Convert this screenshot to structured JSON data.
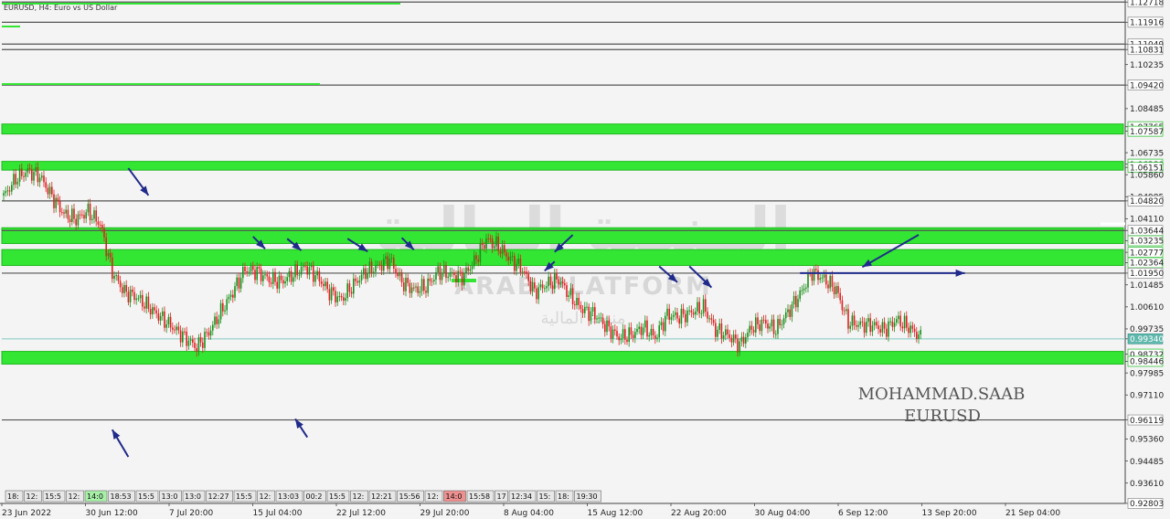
{
  "chart_title": "EURUSD, H4:  Euro vs US Dollar",
  "watermark": {
    "brand_logo": "المنصة المالية",
    "brand_en": "ARAB PLATFORM",
    "brand_ar": "منصة المالية"
  },
  "signature": {
    "author": "MOHAMMAD.SAAB",
    "symbol": "EURUSD"
  },
  "colors": {
    "background": "#f4f4f4",
    "zone": "#33e633",
    "bull": "#1a8f1a",
    "bear": "#e02020",
    "arrow": "#1f2a8a",
    "current_line": "#7fc8c0",
    "level_line": "#555555"
  },
  "price_axis_labels": [
    "1.12718",
    "1.11916",
    "1.11049",
    "1.10831",
    "1.10235",
    "1.09420",
    "1.08485",
    "1.07765",
    "1.07587",
    "1.06735",
    "1.06280",
    "1.06151",
    "1.05860",
    "1.04985",
    "1.04820",
    "1.04110",
    "1.03644",
    "1.03235",
    "1.02777",
    "1.02364",
    "1.01950",
    "1.01485",
    "1.00610",
    "0.99735",
    "0.99340",
    "0.98732",
    "0.98446",
    "0.97985",
    "0.97110",
    "0.96119",
    "0.95360",
    "0.94485",
    "0.93610",
    "0.92803"
  ],
  "time_axis_labels": [
    "23 Jun 2022",
    "30 Jun 12:00",
    "7 Jul 20:00",
    "15 Jul 04:00",
    "22 Jul 12:00",
    "29 Jul 20:00",
    "8 Aug 04:00",
    "15 Aug 12:00",
    "22 Aug 20:00",
    "30 Aug 04:00",
    "6 Sep 12:00",
    "13 Sep 20:00",
    "21 Sep 04:00"
  ],
  "timestamp_boxes": [
    "18:",
    "12:",
    "15:5",
    "12:",
    "14:0",
    "18:53",
    "15:5",
    "13:0",
    "13:0",
    "12:27",
    "15:5",
    "12:",
    "13:03",
    "00:2",
    "15:5",
    "12:",
    "12:21",
    "15:56",
    "12:",
    "14:0",
    "15:58",
    "17",
    "12:34",
    "15:",
    "18:",
    "19:30"
  ],
  "chart_data": {
    "type": "candlestick",
    "symbol": "EURUSD",
    "timeframe": "H4",
    "y_range": [
      0.928,
      1.128
    ],
    "current_price": 0.9934,
    "horizontal_lines": [
      1.12718,
      1.11916,
      1.11049,
      1.10831,
      1.0942,
      1.0482,
      1.03644,
      1.0195,
      0.96119,
      0.92803
    ],
    "zones": [
      {
        "top": 1.07765,
        "bottom": 1.07587
      },
      {
        "top": 1.0628,
        "bottom": 1.06151
      },
      {
        "top": 1.03644,
        "bottom": 1.03235
      },
      {
        "top": 1.02777,
        "bottom": 1.02364
      },
      {
        "top": 0.98732,
        "bottom": 0.98446
      }
    ],
    "close_path": [
      [
        0,
        1.05
      ],
      [
        6,
        1.057
      ],
      [
        12,
        1.06
      ],
      [
        18,
        1.058
      ],
      [
        24,
        1.05
      ],
      [
        30,
        1.043
      ],
      [
        36,
        1.041
      ],
      [
        42,
        1.044
      ],
      [
        48,
        1.039
      ],
      [
        54,
        1.02
      ],
      [
        60,
        1.012
      ],
      [
        66,
        1.01
      ],
      [
        72,
        1.006
      ],
      [
        78,
        1.002
      ],
      [
        84,
        0.998
      ],
      [
        90,
        0.994
      ],
      [
        96,
        0.99
      ],
      [
        102,
        0.996
      ],
      [
        108,
        1.004
      ],
      [
        114,
        1.012
      ],
      [
        120,
        1.021
      ],
      [
        126,
        1.02
      ],
      [
        132,
        1.017
      ],
      [
        138,
        1.016
      ],
      [
        144,
        1.019
      ],
      [
        150,
        1.022
      ],
      [
        156,
        1.018
      ],
      [
        162,
        1.012
      ],
      [
        168,
        1.009
      ],
      [
        174,
        1.015
      ],
      [
        180,
        1.02
      ],
      [
        186,
        1.022
      ],
      [
        192,
        1.025
      ],
      [
        198,
        1.016
      ],
      [
        204,
        1.013
      ],
      [
        210,
        1.014
      ],
      [
        216,
        1.02
      ],
      [
        222,
        1.019
      ],
      [
        228,
        1.018
      ],
      [
        234,
        1.024
      ],
      [
        240,
        1.033
      ],
      [
        246,
        1.03
      ],
      [
        252,
        1.025
      ],
      [
        258,
        1.021
      ],
      [
        264,
        1.012
      ],
      [
        270,
        1.015
      ],
      [
        276,
        1.017
      ],
      [
        282,
        1.01
      ],
      [
        288,
        1.005
      ],
      [
        294,
        1.003
      ],
      [
        300,
        0.998
      ],
      [
        306,
        0.994
      ],
      [
        312,
        0.995
      ],
      [
        318,
        0.998
      ],
      [
        324,
        0.994
      ],
      [
        330,
        1.003
      ],
      [
        336,
        1.002
      ],
      [
        342,
        1.004
      ],
      [
        348,
        1.006
      ],
      [
        354,
        0.997
      ],
      [
        360,
        0.995
      ],
      [
        366,
        0.991
      ],
      [
        372,
        0.998
      ],
      [
        378,
        1.0
      ],
      [
        384,
        0.997
      ],
      [
        390,
        1.004
      ],
      [
        396,
        1.011
      ],
      [
        402,
        1.02
      ],
      [
        408,
        1.017
      ],
      [
        414,
        1.013
      ],
      [
        420,
        1.0
      ],
      [
        426,
        0.999
      ],
      [
        432,
        0.999
      ],
      [
        438,
        0.997
      ],
      [
        444,
        1.001
      ],
      [
        450,
        0.998
      ],
      [
        456,
        0.994
      ]
    ],
    "annotation_arrows": [
      {
        "from": [
          62,
          1.0612
        ],
        "to": [
          72,
          1.0504
        ]
      },
      {
        "from": [
          124,
          1.034
        ],
        "to": [
          130,
          1.0292
        ]
      },
      {
        "from": [
          141,
          1.0332
        ],
        "to": [
          148,
          1.0285
        ]
      },
      {
        "from": [
          171,
          1.0332
        ],
        "to": [
          181,
          1.0281
        ]
      },
      {
        "from": [
          198,
          1.0335
        ],
        "to": [
          204,
          1.0288
        ]
      },
      {
        "from": [
          283,
          1.0347
        ],
        "to": [
          274,
          1.0279
        ]
      },
      {
        "from": [
          274,
          1.0241
        ],
        "to": [
          269,
          1.0204
        ]
      },
      {
        "from": [
          326,
          1.0222
        ],
        "to": [
          335,
          1.0159
        ]
      },
      {
        "from": [
          341,
          1.0222
        ],
        "to": [
          352,
          1.0138
        ]
      },
      {
        "from": [
          455,
          1.0347
        ],
        "to": [
          427,
          1.0219
        ]
      },
      {
        "from": [
          396,
          1.0195
        ],
        "to": [
          478,
          1.0195
        ]
      },
      {
        "from": [
          62,
          0.9465
        ],
        "to": [
          54,
          0.9573
        ]
      },
      {
        "from": [
          151,
          0.9543
        ],
        "to": [
          145,
          0.9616
        ]
      }
    ]
  }
}
